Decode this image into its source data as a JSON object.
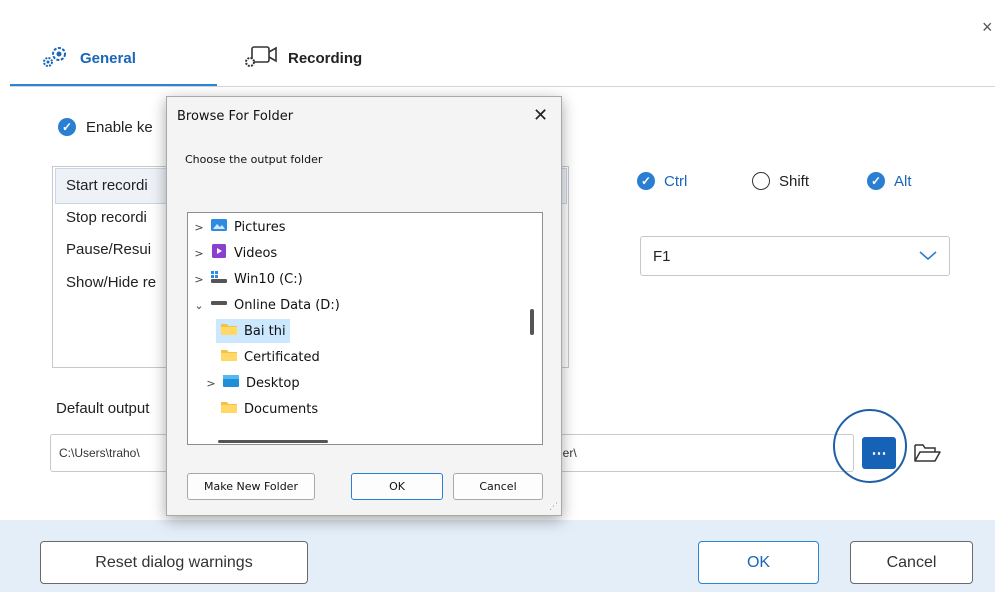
{
  "window": {
    "close_glyph": "×"
  },
  "tabs": [
    {
      "label": "General",
      "icon": "gear-icon",
      "active": true
    },
    {
      "label": "Recording",
      "icon": "camera-settings-icon",
      "active": false
    }
  ],
  "general": {
    "enable_label": "Enable ke",
    "shortcut_items": [
      "Start recordi",
      "Stop recordi",
      "Pause/Resui",
      "Show/Hide re"
    ],
    "modifiers": [
      {
        "label": "Ctrl",
        "checked": true
      },
      {
        "label": "Shift",
        "checked": false
      },
      {
        "label": "Alt",
        "checked": true
      }
    ],
    "key_value": "F1",
    "output_label": "Default output",
    "output_path_left": "C:\\Users\\traho\\",
    "output_path_right": "der\\",
    "browse_glyph": "⋯"
  },
  "footer": {
    "reset_label": "Reset dialog warnings",
    "ok_label": "OK",
    "cancel_label": "Cancel"
  },
  "browse_dialog": {
    "title": "Browse For Folder",
    "close_glyph": "✕",
    "prompt": "Choose the output folder",
    "tree": [
      {
        "label": "Pictures",
        "icon": "pictures-folder-icon",
        "chevron": ">"
      },
      {
        "label": "Videos",
        "icon": "videos-folder-icon",
        "chevron": ">"
      },
      {
        "label": "Win10 (C:)",
        "icon": "drive-icon",
        "chevron": ">"
      },
      {
        "label": "Online Data (D:)",
        "icon": "drive-icon",
        "chevron": "⌄"
      },
      {
        "label": "Bai thi",
        "icon": "folder-icon",
        "chevron": "",
        "selected": true
      },
      {
        "label": "Certificated",
        "icon": "folder-icon",
        "chevron": ""
      },
      {
        "label": "Desktop",
        "icon": "desktop-folder-icon",
        "chevron": ">"
      },
      {
        "label": "Documents",
        "icon": "folder-icon",
        "chevron": ""
      }
    ],
    "new_folder_label": "Make New Folder",
    "ok_label": "OK",
    "cancel_label": "Cancel"
  },
  "colors": {
    "accent": "#2a86d4",
    "footer_bg": "#e4eef8",
    "selection": "#cce8ff",
    "browse_button": "#1662b6"
  }
}
